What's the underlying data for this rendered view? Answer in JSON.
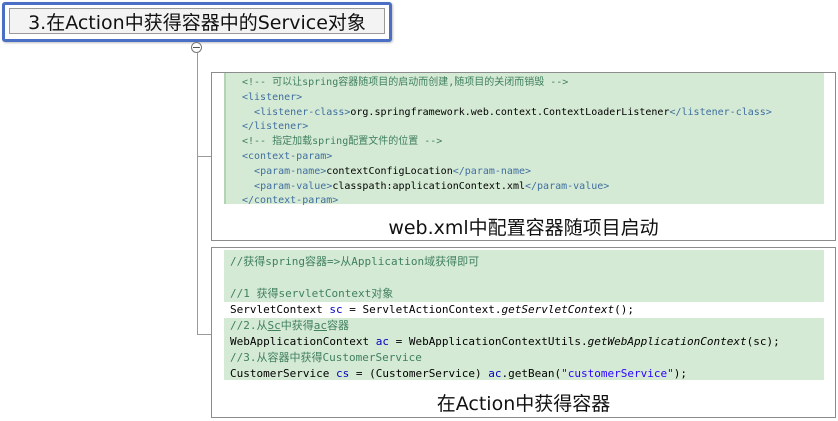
{
  "title_node": {
    "text": "3.在Action中获得容器中的Service对象"
  },
  "toggle": {
    "glyph": "−"
  },
  "node_web_xml": {
    "caption": "web.xml中配置容器随项目启动",
    "code": {
      "l1": "<!-- 可以让spring容器随项目的启动而创建,随项目的关闭而销毁 -->",
      "l2_open": "<listener>",
      "l3_open": "<listener-class>",
      "l3_value": "org.springframework.web.context.ContextLoaderListener",
      "l3_close": "</listener-class>",
      "l4_close": "</listener>",
      "l5": "<!-- 指定加载spring配置文件的位置 -->",
      "l6_open": "<context-param>",
      "l7_open": "<param-name>",
      "l7_value": "contextConfigLocation",
      "l7_close": "</param-name>",
      "l8_open": "<param-value>",
      "l8_value": "classpath:applicationContext.xml",
      "l8_close": "</param-value>",
      "l9_close": "</context-param>"
    }
  },
  "node_action": {
    "caption": "在Action中获得容器",
    "code": {
      "c1": "//获得spring容器=>从Application域获得即可",
      "c2": "//1 获得servletContext对象",
      "s3_type": "ServletContext ",
      "s3_var": "sc",
      "s3_eq": " = ServletActionContext.",
      "s3_call": "getServletContext",
      "s3_end": "();",
      "c4_a": "//2.从",
      "c4_b": "Sc",
      "c4_c": "中获得",
      "c4_d": "ac",
      "c4_e": "容器",
      "s5_type": "WebApplicationContext ",
      "s5_var": "ac",
      "s5_eq": " = WebApplicationContextUtils.",
      "s5_call": "getWebApplicationContext",
      "s5_end": "(sc);",
      "c6": "//3.从容器中获得CustomerService",
      "s7_type": "CustomerService ",
      "s7_var": "cs",
      "s7_eq": " = (CustomerService) ",
      "s7_ac": "ac",
      "s7_get": ".getBean(",
      "s7_str": "\"customerService\"",
      "s7_end": ");"
    }
  }
}
